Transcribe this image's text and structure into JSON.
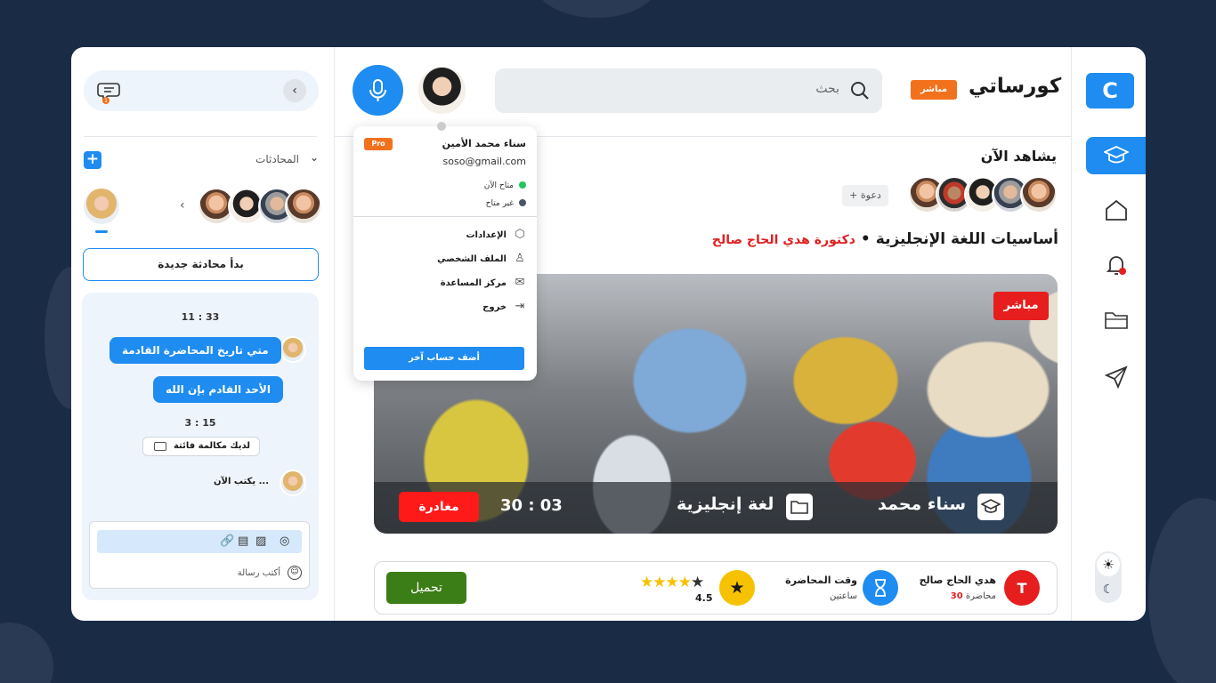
{
  "brand": {
    "name": "كورساتي",
    "live_badge": "مباشر",
    "logo_letter": "C"
  },
  "search": {
    "placeholder": "بحث"
  },
  "profile_menu": {
    "name": "سناء محمد الأمين",
    "email": "soso@gmail.com",
    "pro_badge": "Pro",
    "status_available": "متاح الآن",
    "status_unavailable": "غير متاح",
    "items": [
      {
        "label": "الإعدادات",
        "icon": "settings-icon"
      },
      {
        "label": "الملف الشخصي",
        "icon": "user-icon"
      },
      {
        "label": "مركز المساعدة",
        "icon": "help-chat-icon"
      },
      {
        "label": "خروج",
        "icon": "logout-icon"
      }
    ],
    "add_account": "أضف حساب آخر",
    "colors": {
      "available": "#22c55e",
      "unavailable": "#4b5563"
    }
  },
  "watching": {
    "title": "يشاهد الآن",
    "invite": "+ دعوة"
  },
  "course": {
    "title": "أساسيات اللغة الإنجليزية",
    "separator": "•",
    "teacher": "دكتورة هدي الحاج صالح"
  },
  "video": {
    "live": "مباشر",
    "leave": "مغادرة",
    "timer": "30 : 03",
    "subject": "لغة إنجليزية",
    "student": "سناء محمد"
  },
  "info": {
    "download": "تحميل",
    "teacher_name": "هدي الحاج صالح",
    "lectures_count": "30",
    "lectures_label": "محاضرة",
    "teacher_initial": "T",
    "time_title": "وقت المحاضرة",
    "time_value": "ساعتين",
    "rating": "4.5",
    "stars": "★★★★★",
    "rating_stars": 4
  },
  "chat": {
    "conversations_label": "المحادثات",
    "add": "+",
    "new_chat": "بدأ محادثة جديدة",
    "time1": "11 : 33",
    "msg1": "متي تاريخ المحاضرة  القادمة",
    "msg2": "الأحد القادم بإن الله",
    "time2": "3 : 15",
    "missed_call": "لديك مكالمة فائتة",
    "typing": "يكتب الآن ...",
    "composer_placeholder": "أكتب رسالة",
    "notif_count": "1"
  },
  "colors": {
    "primary": "#1e8cf0",
    "accent": "#f2711c",
    "danger": "#e61e1e",
    "download": "#3b7d16"
  }
}
